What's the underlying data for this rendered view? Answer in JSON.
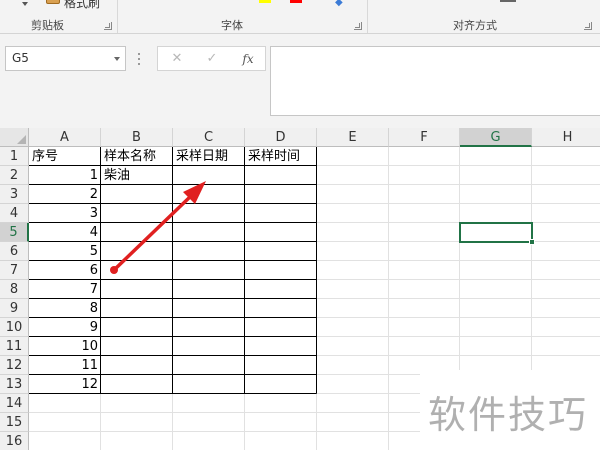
{
  "ribbon": {
    "clipboard_label": "剪贴板",
    "format_painter_label": "格式刷",
    "font_label": "字体",
    "alignment_label": "对齐方式"
  },
  "formula_bar": {
    "name_box": "G5",
    "cancel_symbol": "✕",
    "enter_symbol": "✓",
    "function_symbol": "fx",
    "formula": ""
  },
  "sheet": {
    "columns": [
      "A",
      "B",
      "C",
      "D",
      "E",
      "F",
      "G",
      "H"
    ],
    "rows": [
      "1",
      "2",
      "3",
      "4",
      "5",
      "6",
      "7",
      "8",
      "9",
      "10",
      "11",
      "12",
      "13",
      "14",
      "15",
      "16"
    ],
    "selected_cell": "G5",
    "headers": [
      "序号",
      "样本名称",
      "采样日期",
      "采样时间"
    ],
    "serials": [
      "1",
      "2",
      "3",
      "4",
      "5",
      "6",
      "7",
      "8",
      "9",
      "10",
      "11",
      "12"
    ],
    "sample_b2": "柴油"
  },
  "annotation": {
    "arrow_color": "#e02020"
  },
  "watermark": {
    "text": "软件技巧"
  }
}
